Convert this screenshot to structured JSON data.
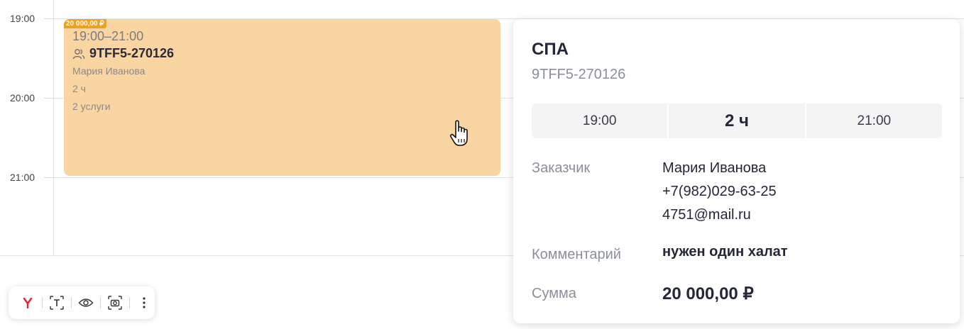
{
  "calendar": {
    "hours": [
      "19:00",
      "20:00",
      "21:00"
    ]
  },
  "event": {
    "price_badge": "20 000,00 ₽",
    "time_range": "19:00–21:00",
    "code": "9TFF5-270126",
    "customer": "Мария Иванова",
    "duration": "2 ч",
    "services": "2 услуги",
    "color": "#f9d5a2",
    "badge_color": "#f0a020"
  },
  "popover": {
    "title": "СПА",
    "code": "9TFF5-270126",
    "start": "19:00",
    "duration": "2 ч",
    "end": "21:00",
    "customer_label": "Заказчик",
    "customer_name": "Мария Иванова",
    "customer_phone": "+7(982)029-63-25",
    "customer_email": "4751@mail.ru",
    "comment_label": "Комментарий",
    "comment_value": "нужен один халат",
    "sum_label": "Сумма",
    "sum_value": "20 000,00 ₽"
  },
  "toolbar": {
    "icons": [
      "yandex-icon",
      "text-recognition-icon",
      "eye-icon",
      "screenshot-icon",
      "more-vertical-icon"
    ]
  }
}
